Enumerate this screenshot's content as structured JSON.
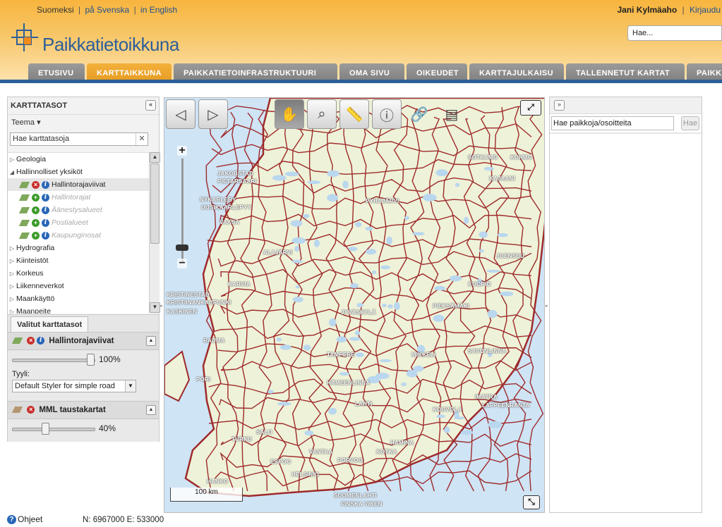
{
  "header": {
    "languages": [
      "Suomeksi",
      "på Svenska",
      "in English"
    ],
    "separator": "|",
    "user_name": "Jani Kylmäaho",
    "logout_label": "Kirjaudu",
    "logo_text": "Paikkatietoikkuna",
    "search_placeholder": "Hae..."
  },
  "tabs": [
    {
      "label": "ETUSIVU",
      "active": false
    },
    {
      "label": "KARTTAIKKUNA",
      "active": true
    },
    {
      "label": "PAIKKATIETOINFRASTRUKTUURI",
      "active": false
    },
    {
      "label": "OMA SIVU",
      "active": false
    },
    {
      "label": "OIKEUDET",
      "active": false
    },
    {
      "label": "KARTTAJULKAISU",
      "active": false
    },
    {
      "label": "TALLENNETUT KARTAT",
      "active": false
    },
    {
      "label": "PAIKKA",
      "active": false
    }
  ],
  "left_panel": {
    "title": "KARTTATASOT",
    "collapse_icon": "«",
    "grouping_label": "Teema ▾",
    "search_placeholder": "Hae karttatasoja",
    "clear_icon": "✕",
    "tree": {
      "group_geologia": "Geologia",
      "group_hallinnolliset": "Hallinnolliset yksiköt",
      "sub_layers": [
        {
          "label": "Hallintorajaviivat",
          "selected": true
        },
        {
          "label": "Hallintorajat",
          "selected": false
        },
        {
          "label": "Äänestysalueet",
          "selected": false
        },
        {
          "label": "Postialueet",
          "selected": false
        },
        {
          "label": "Kaupunginosat",
          "selected": false
        }
      ],
      "groups_after": [
        "Hydrografia",
        "Kiinteistöt",
        "Korkeus",
        "Liikenneverkot",
        "Maankäyttö",
        "Maanpeite"
      ]
    },
    "selected_tab_label": "Valitut karttatasot",
    "selected_layers": [
      {
        "name": "Hallintorajaviivat",
        "opacity": 100,
        "opacity_label": "100%",
        "style_label": "Tyyli:",
        "style_value": "Default Styler for simple road"
      },
      {
        "name": "MML taustakartat",
        "opacity": 40,
        "opacity_label": "40%"
      }
    ]
  },
  "map": {
    "toolbar": [
      "back-icon",
      "forward-icon",
      "pan-hand-icon",
      "zoom-box-icon",
      "measure-ruler-icon",
      "info-cursor-icon",
      "link-icon",
      "print-preview-icon"
    ],
    "active_tool": "pan-hand-icon",
    "zoom_plus": "+",
    "zoom_minus": "−",
    "scale_label": "100 km",
    "fullscreen_icon": "⤢",
    "minimize_icon": "⤡",
    "place_labels": [
      "JAKOBSTAD",
      "PIETARSAARI",
      "NYKARLEBY",
      "UUSIKAARLEPYY",
      "VAASA",
      "KUHMO",
      "KAJAANI",
      "SOTKAMO",
      "PYHÄJÄRVI",
      "ALAJÄRVI",
      "KARVIA",
      "TAMPERE",
      "KUOPIO",
      "PIEKSÄMÄKI",
      "JOENSUU",
      "SAVONLINNA",
      "IMATRA",
      "LAPPEENRANTA",
      "KOUVOLA",
      "HAMINA",
      "KOTKA",
      "PORVOO",
      "HELSINKI",
      "ESPOO",
      "VANTAA",
      "HANKO",
      "TURKU",
      "SALO",
      "KRISTINESTAD",
      "KRISTIINANKAUPUNKI",
      "KASKINEN",
      "RAUMA",
      "PORI",
      "LAHTI",
      "MIKKELI",
      "JYVÄSKYLÄ",
      "HÄMEENLINNA",
      "SUOMENLAHTI",
      "FINSKA VIKEN"
    ]
  },
  "right_panel": {
    "expand_icon": "»",
    "search_value": "Hae paikkoja/osoitteita",
    "search_button": "Hae"
  },
  "footer": {
    "help_label": "Ohjeet",
    "coordinates": "N: 6967000 E: 533000"
  },
  "colors": {
    "header_orange": "#f8b53e",
    "active_tab": "#e69a20",
    "inactive_tab": "#8a8a8a",
    "brand_blue": "#2d5f99",
    "border_red": "#9e2a2b",
    "sea": "#cfe4f5"
  }
}
